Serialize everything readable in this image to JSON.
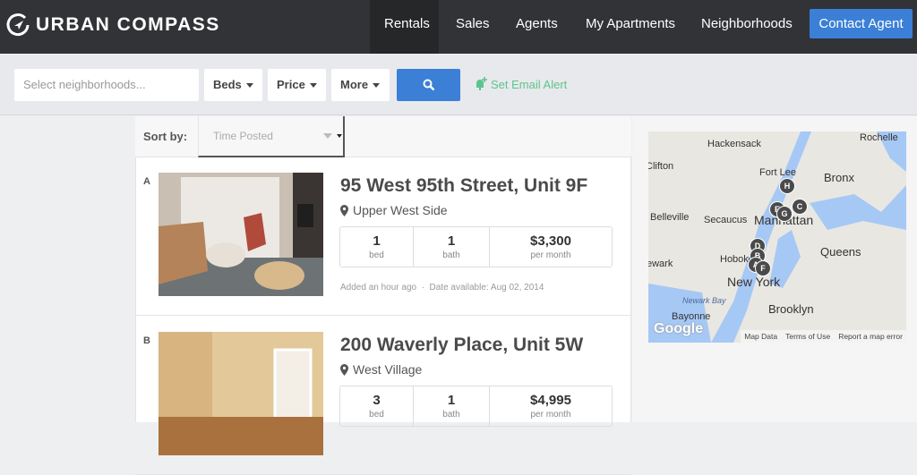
{
  "header": {
    "brand": "URBAN COMPASS",
    "nav": [
      "Rentals",
      "Sales",
      "Agents",
      "My Apartments",
      "Neighborhoods"
    ],
    "active": "Rentals",
    "contact_label": "Contact Agent"
  },
  "filters": {
    "neighborhood_placeholder": "Select neighborhoods...",
    "beds": "Beds",
    "price": "Price",
    "more": "More",
    "email_alert": "Set Email Alert"
  },
  "sort": {
    "label": "Sort by:",
    "value": "Time Posted"
  },
  "listings": [
    {
      "letter": "A",
      "title": "95 West 95th Street, Unit 9F",
      "location": "Upper West Side",
      "beds": "1",
      "beds_label": "bed",
      "baths": "1",
      "baths_label": "bath",
      "price": "$3,300",
      "price_label": "per month",
      "added": "Added an hour ago",
      "available": "Date available: Aug 02, 2014"
    },
    {
      "letter": "B",
      "title": "200 Waverly Place, Unit 5W",
      "location": "West Village",
      "beds": "3",
      "beds_label": "bed",
      "baths": "1",
      "baths_label": "bath",
      "price": "$4,995",
      "price_label": "per month"
    }
  ],
  "map": {
    "labels": [
      "Hackensack",
      "Clifton",
      "Fort Lee",
      "Bronx",
      "Belleville",
      "Secaucus",
      "Manhattan",
      "Queens",
      "Hoboken",
      "ewark",
      "New York",
      "Newark Bay",
      "Bayonne",
      "Brooklyn",
      "Rochelle"
    ],
    "markers": [
      "H",
      "E",
      "C",
      "G",
      "D",
      "B",
      "A",
      "F"
    ],
    "google": "Google",
    "footer": [
      "Map Data",
      "Terms of Use",
      "Report a map error"
    ]
  },
  "colors": {
    "header": "#323336",
    "accent": "#3b7fd6",
    "alert": "#5cc58f"
  }
}
